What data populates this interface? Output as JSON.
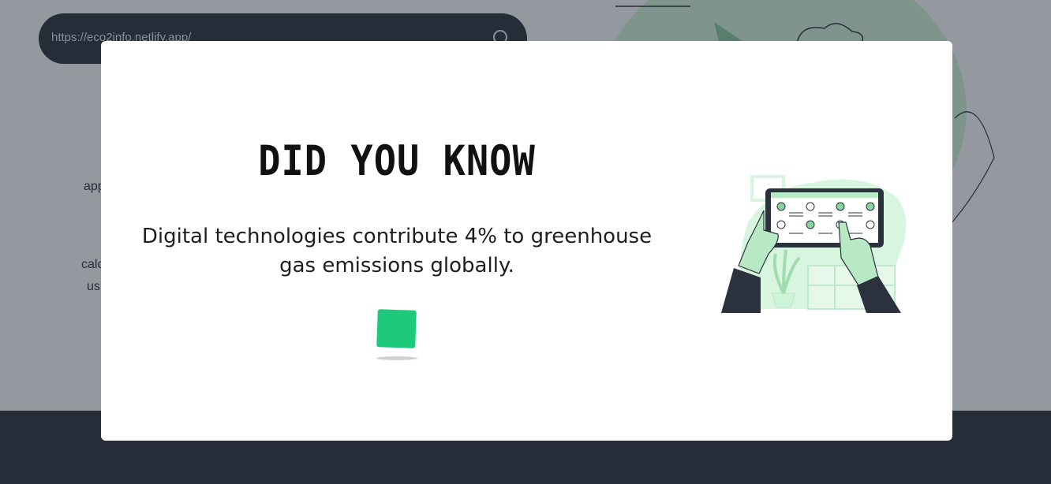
{
  "background": {
    "url_bar": {
      "value": "https://eco2info.netlify.app/"
    },
    "fragments": [
      "app",
      "calc",
      "us"
    ]
  },
  "modal": {
    "title": "DID YOU KNOW",
    "message": "Digital technologies contribute 4% to greenhouse gas emissions globally."
  },
  "colors": {
    "accent": "#1dca7a",
    "dark": "#2c323d",
    "illustration_green": "#cdf3d8"
  },
  "icons": [
    "search-icon",
    "loader-square",
    "tablet-illustration"
  ]
}
